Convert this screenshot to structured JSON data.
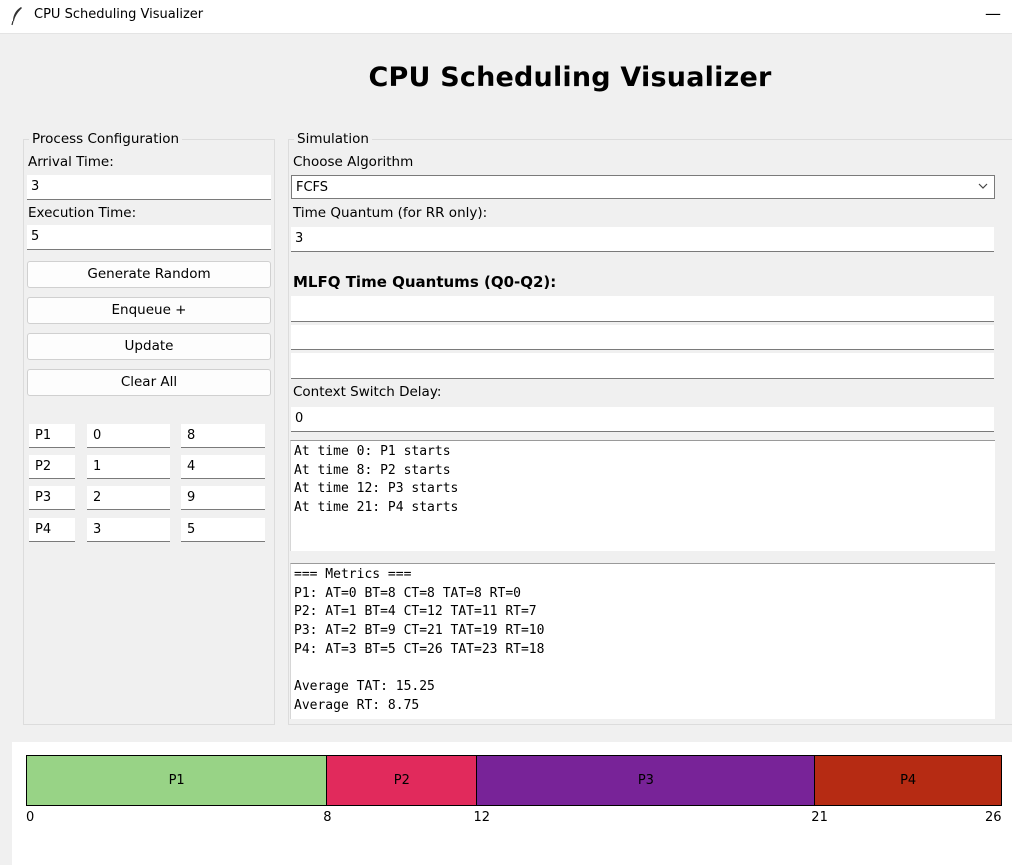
{
  "window": {
    "title": "CPU Scheduling Visualizer",
    "minimize": "—"
  },
  "app_title": "CPU Scheduling Visualizer",
  "process_config": {
    "legend": "Process Configuration",
    "arrival_label": "Arrival Time:",
    "arrival_value": "3",
    "execution_label": "Execution Time:",
    "execution_value": "5",
    "buttons": [
      "Generate Random",
      "Enqueue +",
      "Update",
      "Clear All"
    ],
    "processes": [
      {
        "name": "P1",
        "arrival": "0",
        "burst": "8"
      },
      {
        "name": "P2",
        "arrival": "1",
        "burst": "4"
      },
      {
        "name": "P3",
        "arrival": "2",
        "burst": "9"
      },
      {
        "name": "P4",
        "arrival": "3",
        "burst": "5"
      }
    ]
  },
  "simulation": {
    "legend": "Simulation",
    "algorithm_label": "Choose Algorithm",
    "algorithm_value": "FCFS",
    "quantum_label": "Time Quantum (for RR only):",
    "quantum_value": "3",
    "mlfq_label": "MLFQ Time Quantums (Q0-Q2):",
    "mlfq_values": [
      "",
      "",
      ""
    ],
    "context_label": "Context Switch Delay:",
    "context_value": "0",
    "log_text": "At time 0: P1 starts\nAt time 8: P2 starts\nAt time 12: P3 starts\nAt time 21: P4 starts",
    "metrics_text": "=== Metrics ===\nP1: AT=0 BT=8 CT=8 TAT=8 RT=0\nP2: AT=1 BT=4 CT=12 TAT=11 RT=7\nP3: AT=2 BT=9 CT=21 TAT=19 RT=10\nP4: AT=3 BT=5 CT=26 TAT=23 RT=18\n\nAverage TAT: 15.25\nAverage RT: 8.75"
  },
  "gantt": {
    "total": 26,
    "segments": [
      {
        "label": "P1",
        "start": 0,
        "end": 8,
        "color": "#98d386"
      },
      {
        "label": "P2",
        "start": 8,
        "end": 12,
        "color": "#e12a5c"
      },
      {
        "label": "P3",
        "start": 12,
        "end": 21,
        "color": "#782398"
      },
      {
        "label": "P4",
        "start": 21,
        "end": 26,
        "color": "#b62b13"
      }
    ],
    "ticks": [
      "0",
      "8",
      "12",
      "21",
      "26"
    ]
  }
}
